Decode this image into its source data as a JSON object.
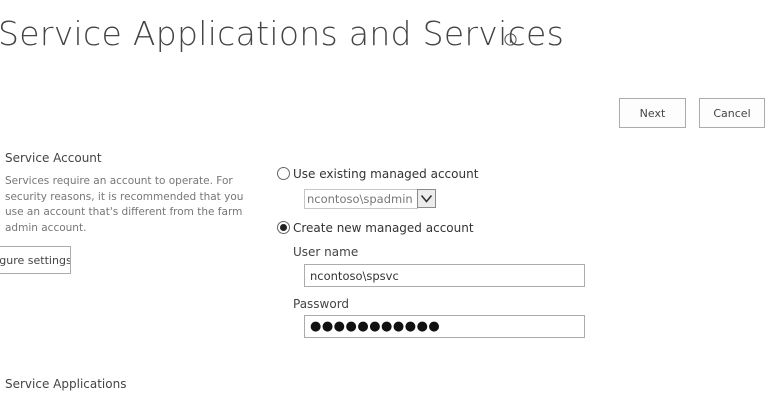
{
  "page": {
    "title": "Service Applications and Services",
    "info_icon": "info-circle-icon"
  },
  "toolbar": {
    "next_label": "Next",
    "cancel_label": "Cancel"
  },
  "service_account": {
    "title": "Service Account",
    "description": "Services require an account to operate. For security reasons, it is recommended that you use an account that's different from the farm admin account.",
    "secure_button_label": "Configure settings",
    "options": {
      "existing": {
        "label": "Use existing managed account",
        "selected": false,
        "account_value": "ncontoso\\spadmin"
      },
      "create": {
        "label": "Create new managed account",
        "selected": true
      }
    },
    "user_name": {
      "label": "User name",
      "value": "ncontoso\\spsvc"
    },
    "password": {
      "label": "Password",
      "value": "●●●●●●●●●●●"
    }
  },
  "service_applications": {
    "title": "Service Applications"
  }
}
